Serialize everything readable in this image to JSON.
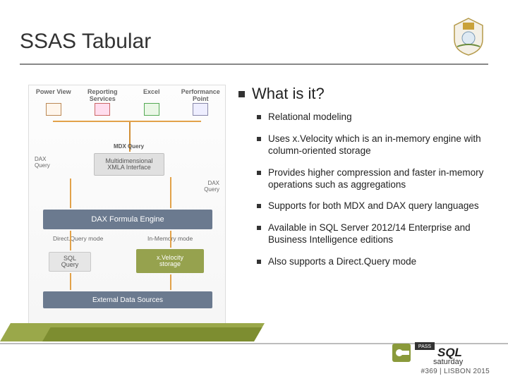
{
  "title": "SSAS Tabular",
  "main_heading": "What is it?",
  "bullets": [
    "Relational modeling",
    "Uses x.Velocity which is an in-memory engine with column-oriented storage",
    "Provides higher compression and faster in-memory operations such as aggregations",
    "Supports for both MDX and DAX query languages",
    "Available in SQL Server 2012/14 Enterprise and Business Intelligence editions",
    "Also supports a Direct.Query mode"
  ],
  "diagram": {
    "clients": [
      "Power View",
      "Reporting Services",
      "Excel",
      "Performance Point"
    ],
    "mdx_query": "MDX Query",
    "dax_query": "DAX Query",
    "dax_query2": "DAX Query",
    "multi_box_l1": "Multidimensional",
    "multi_box_l2": "XMLA Interface",
    "formula_box": "DAX Formula Engine",
    "mode_dq": "Direct.Query mode",
    "mode_mem": "In-Memory mode",
    "sql_box_l1": "SQL",
    "sql_box_l2": "Query",
    "xvel_box_l1": "x.Velocity",
    "xvel_box_l2": "storage",
    "ext_box": "External Data Sources"
  },
  "footer": {
    "event": "#369 | LISBON 2015",
    "logo_top": "PASS",
    "logo_main": "SQL",
    "logo_sub": "saturday"
  }
}
